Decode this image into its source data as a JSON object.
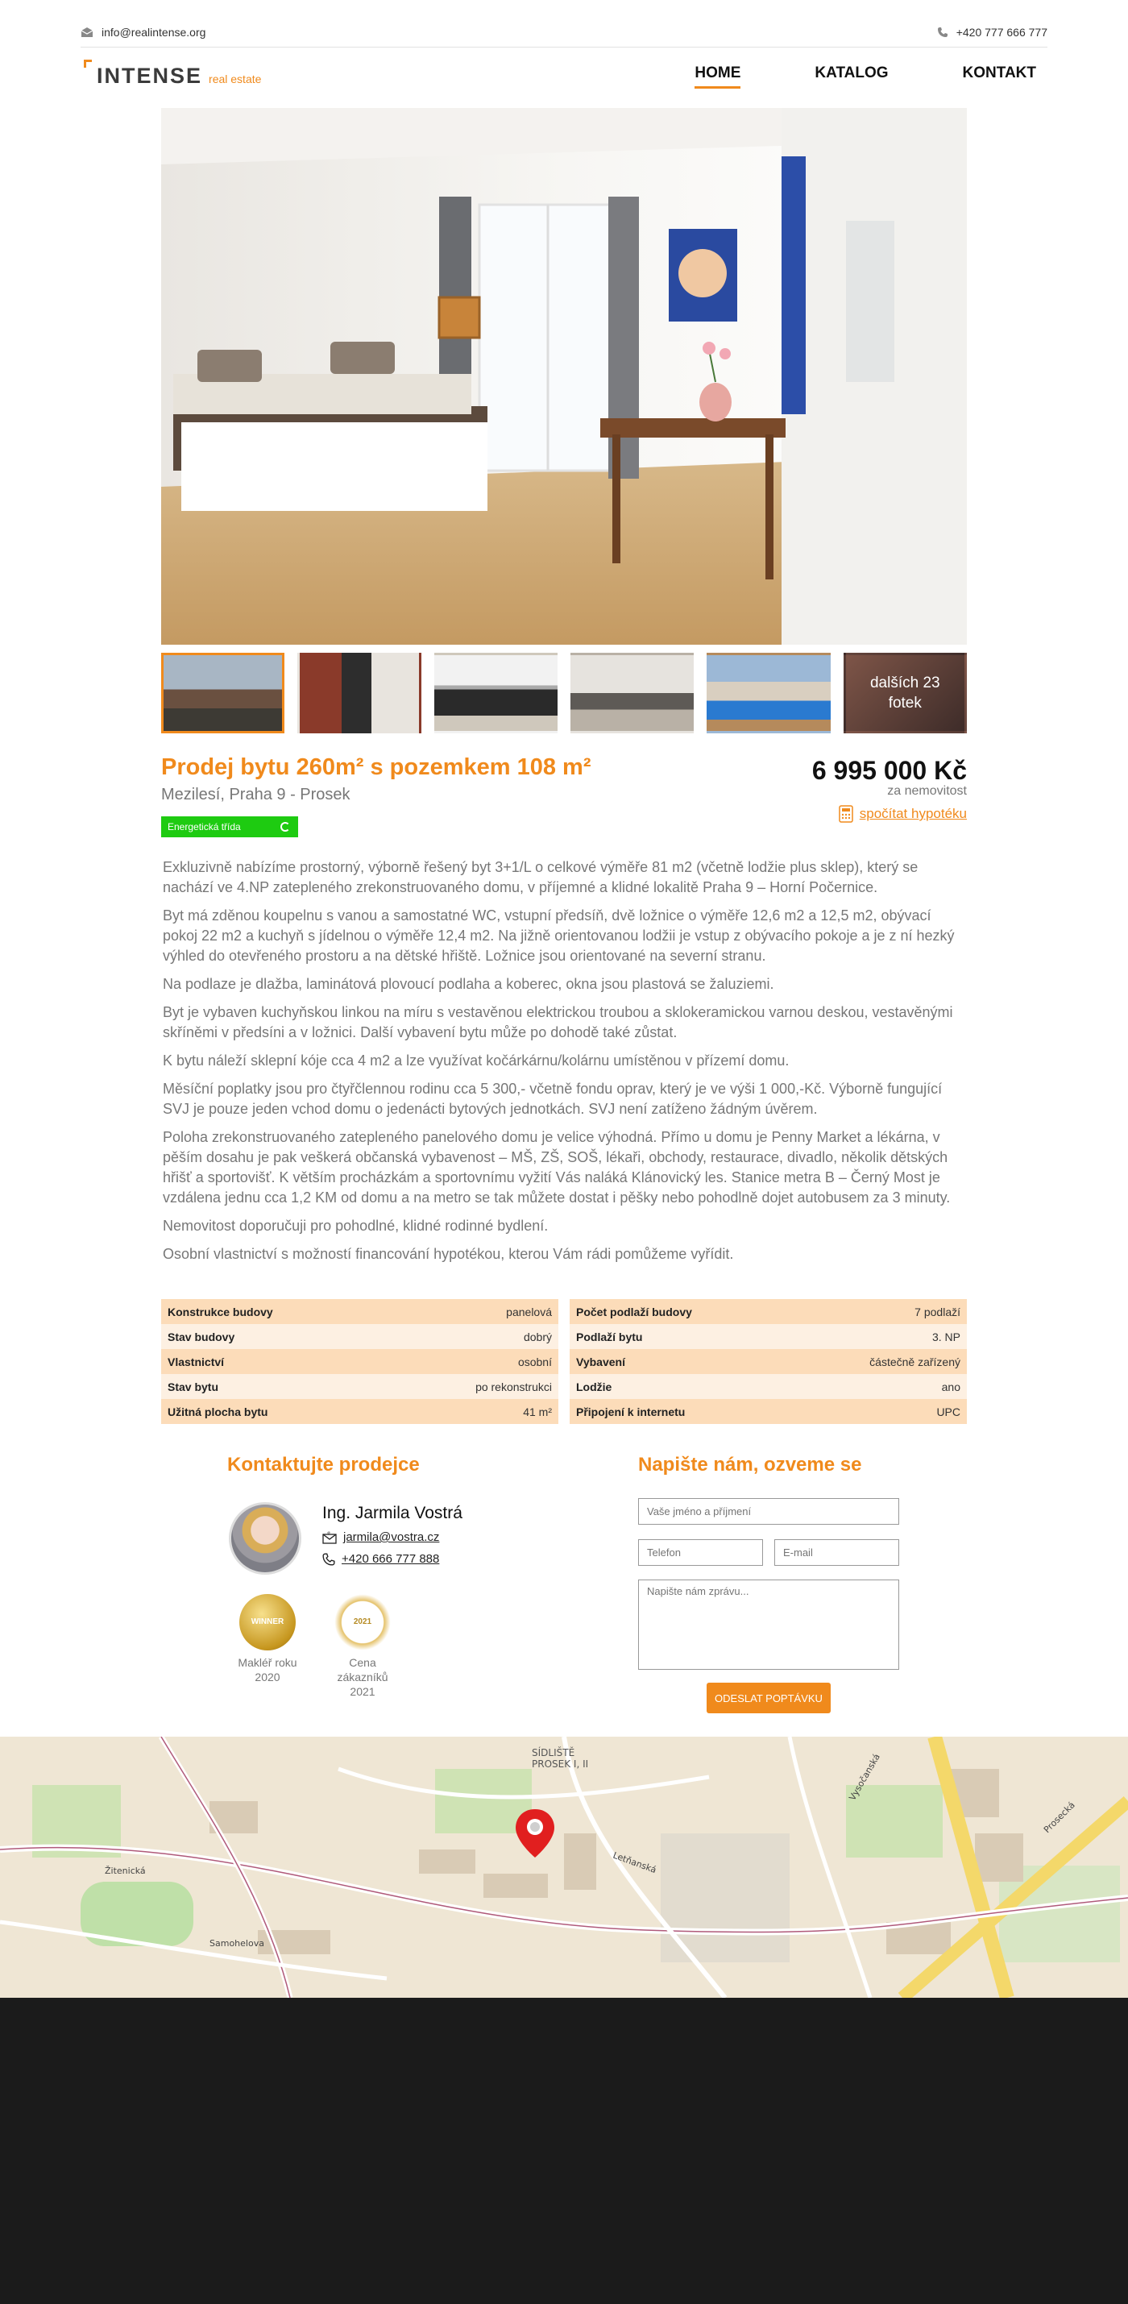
{
  "topbar": {
    "email": "info@realintense.org",
    "phone": "+420 777 666 777",
    "mail_icon": "envelope-icon",
    "phone_icon": "phone-icon"
  },
  "brand": {
    "name": "INTENSE",
    "tagline": "real estate",
    "accent": "#f08a1c"
  },
  "nav": [
    {
      "label": "HOME",
      "active": true
    },
    {
      "label": "KATALOG",
      "active": false
    },
    {
      "label": "KONTAKT",
      "active": false
    }
  ],
  "gallery": {
    "more_line1": "dalších 23",
    "more_line2": "fotek"
  },
  "listing": {
    "title": "Prodej bytu 260m² s pozemkem 108 m²",
    "location": "Mezilesí, Praha 9 - Prosek",
    "energy_label": "Energetická třída",
    "price": "6 995 000 Kč",
    "price_note": "za nemovitost",
    "mortgage_link": "spočítat hypotéku"
  },
  "description": [
    "Exkluzivně nabízíme prostorný, výborně řešený byt 3+1/L o celkové výměře 81 m2 (včetně lodžie plus sklep), který se nachází ve 4.NP zatepleného zrekonstruovaného domu, v příjemné a klidné lokalitě Praha 9 – Horní Počernice.",
    "Byt má zděnou koupelnu s vanou a samostatné WC, vstupní předsíň, dvě ložnice o výměře 12,6 m2 a 12,5 m2, obývací pokoj 22 m2 a kuchyň s jídelnou o výměře 12,4 m2. Na jižně orientovanou lodžii je vstup z obývacího pokoje a je z ní hezký výhled do otevřeného prostoru a na dětské hřiště. Ložnice jsou orientované na severní stranu.",
    "Na podlaze je dlažba, laminátová plovoucí podlaha a koberec, okna jsou plastová se žaluziemi.",
    "Byt je vybaven kuchyňskou linkou na míru s vestavěnou elektrickou troubou a sklokeramickou varnou deskou, vestavěnými skříněmi v předsíni a v ložnici. Další vybavení bytu může po dohodě také zůstat.",
    "K bytu náleží sklepní kóje cca 4 m2 a lze využívat kočárkárnu/kolárnu umístěnou v přízemí domu.",
    "Měsíční poplatky jsou pro čtyřčlennou rodinu cca 5 300,- včetně fondu oprav, který je ve výši 1 000,-Kč. Výborně fungující SVJ je pouze jeden vchod domu o jedenácti bytových jednotkách. SVJ není zatíženo žádným úvěrem.",
    "Poloha zrekonstruovaného zatepleného panelového domu je velice výhodná. Přímo u domu je Penny Market a lékárna, v pěším dosahu je pak veškerá občanská vybavenost – MŠ, ZŠ, SOŠ, lékaři, obchody, restaurace, divadlo, několik dětských hřišť a sportovišť. K větším procházkám a sportovnímu vyžití Vás naláká Klánovický les. Stanice metra B – Černý Most je vzdálena jednu cca 1,2 KM od domu a na metro se tak můžete dostat i pěšky nebo pohodlně dojet autobusem za 3 minuty.",
    "Nemovitost doporučuji pro pohodlné, klidné rodinné bydlení.",
    "Osobní vlastnictví s možností financování hypotékou, kterou Vám rádi pomůžeme vyřídit."
  ],
  "params_left": [
    {
      "k": "Konstrukce budovy",
      "v": "panelová"
    },
    {
      "k": "Stav budovy",
      "v": "dobrý"
    },
    {
      "k": "Vlastnictví",
      "v": "osobní"
    },
    {
      "k": "Stav bytu",
      "v": "po rekonstrukci"
    },
    {
      "k": "Užitná plocha bytu",
      "v": "41 m²"
    }
  ],
  "params_right": [
    {
      "k": "Počet podlaží budovy",
      "v": "7 podlaží"
    },
    {
      "k": "Podlaží bytu",
      "v": "3. NP"
    },
    {
      "k": "Vybavení",
      "v": "částečně zařízený"
    },
    {
      "k": "Lodžie",
      "v": "ano"
    },
    {
      "k": "Připojení k internetu",
      "v": "UPC"
    }
  ],
  "contact": {
    "heading": "Kontaktujte prodejce",
    "name": "Ing. Jarmila Vostrá",
    "email": "jarmila@vostra.cz",
    "phone": "+420 666 777 888",
    "award1_medal": "WINNER",
    "award1_line1": "Makléř roku",
    "award1_line2": "2020",
    "award2_medal": "2021",
    "award2_line1": "Cena zákazníků",
    "award2_line2": "2021"
  },
  "form": {
    "heading": "Napište nám, ozveme se",
    "name_placeholder": "Vaše jméno a příjmení",
    "phone_placeholder": "Telefon",
    "email_placeholder": "E-mail",
    "message_placeholder": "Napište nám zprávu...",
    "submit": "ODESLAT POPTÁVKU"
  },
  "map": {
    "labels": {
      "sidliste": "SÍDLIŠTĚ",
      "prosek": "PROSEK I, II",
      "street1": "Letňanská",
      "street2": "Vysočanská",
      "street3": "Prosecká",
      "street4": "Žitenická",
      "street5": "Samohelova"
    }
  }
}
